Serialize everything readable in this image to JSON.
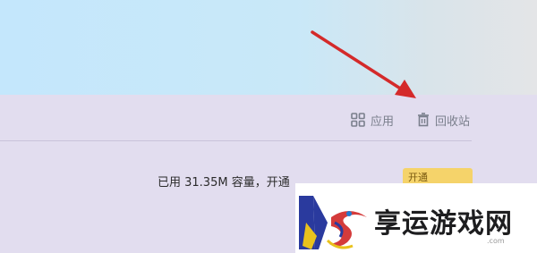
{
  "toolbar": {
    "apps_label": "应用",
    "apps_icon": "grid-icon",
    "trash_label": "回收站",
    "trash_icon": "trash-icon"
  },
  "storage": {
    "text": "已用 31.35M 容量，开通",
    "upgrade_label": "开通"
  },
  "watermark": {
    "text": "享运游戏网",
    "domain": ".com"
  },
  "colors": {
    "banner": "#c4e7fc",
    "panel": "#e2ddef",
    "arrow": "#d42a2a",
    "upgrade": "#f5d36a"
  }
}
